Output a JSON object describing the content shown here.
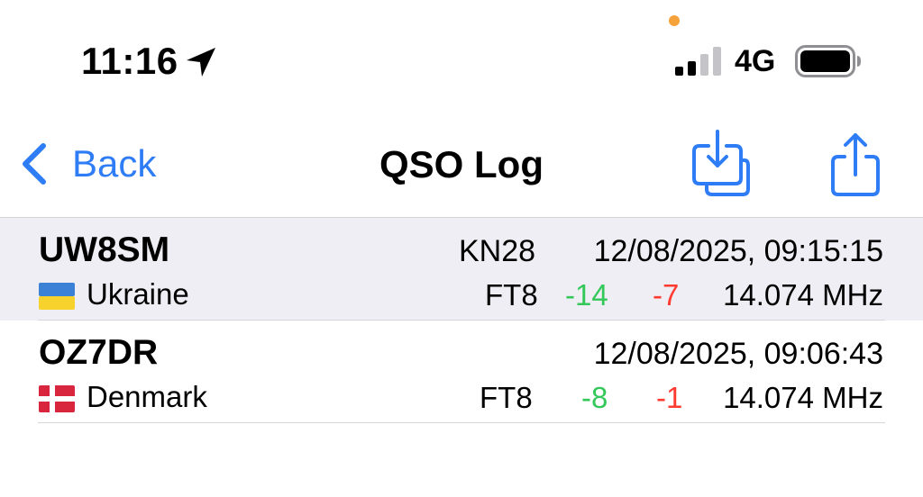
{
  "status_bar": {
    "time": "11:16",
    "network": "4G",
    "privacy_indicator_color": "#f5a23a",
    "icons": [
      "location-arrow-icon",
      "cellular-signal-icon",
      "battery-icon"
    ]
  },
  "nav": {
    "back_label": "Back",
    "title": "QSO Log",
    "accent_color": "#2f7df6",
    "icons": [
      "chevron-left-icon",
      "import-icon",
      "share-icon"
    ]
  },
  "log": [
    {
      "callsign": "UW8SM",
      "grid": "KN28",
      "datetime": "12/08/2025, 09:15:15",
      "country": "Ukraine",
      "flag_icon": "flag-ukraine-icon",
      "mode": "FT8",
      "snr_sent": "-14",
      "snr_rcvd": "-7",
      "frequency": "14.074 MHz",
      "selected": true
    },
    {
      "callsign": "OZ7DR",
      "grid": "",
      "datetime": "12/08/2025, 09:06:43",
      "country": "Denmark",
      "flag_icon": "flag-denmark-icon",
      "mode": "FT8",
      "snr_sent": "-8",
      "snr_rcvd": "-1",
      "frequency": "14.074 MHz",
      "selected": false
    }
  ],
  "colors": {
    "snr_sent": "#34c759",
    "snr_rcvd": "#ff3b30",
    "selected_row_bg": "#efeef4"
  }
}
